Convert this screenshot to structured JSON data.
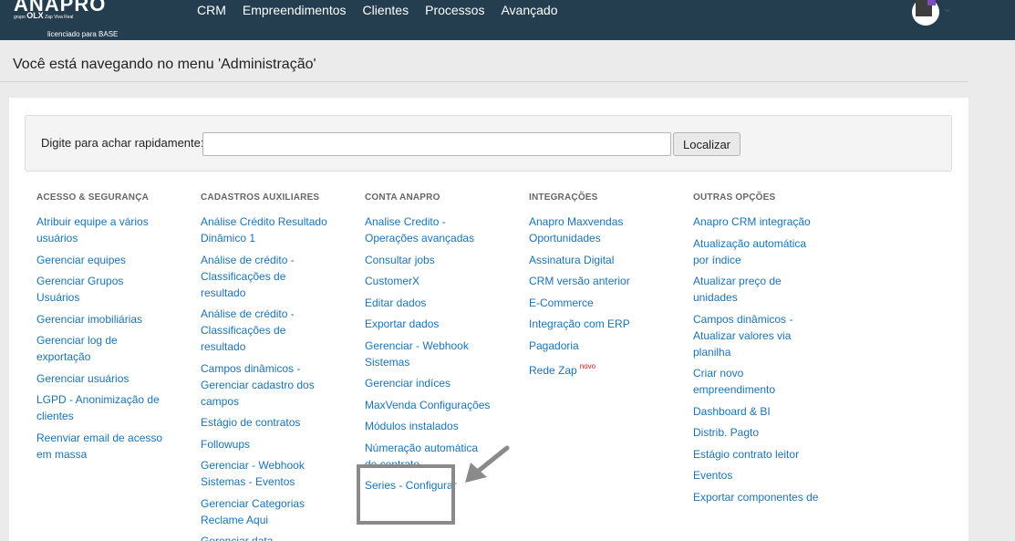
{
  "topbar": {
    "logo_text": "ANAPRO",
    "logo_sub_prefix": "grupo",
    "logo_sub_brand": "OLX",
    "logo_sub_rest": "Zap  Viva  Real",
    "licensed": "licenciado para BASE",
    "nav": [
      "CRM",
      "Empreendimentos",
      "Clientes",
      "Processos",
      "Avançado"
    ],
    "avatar_chevron": "⌄"
  },
  "page": {
    "title": "Você está navegando no menu 'Administração'"
  },
  "search": {
    "label": "Digite para achar rapidamente:",
    "value": "",
    "placeholder": "",
    "button": "Localizar"
  },
  "columns": [
    {
      "heading": "ACESSO & SEGURANÇA",
      "items": [
        "Atribuir equipe a vários usuários",
        "Gerenciar equipes",
        "Gerenciar Grupos Usuários",
        "Gerenciar imobiliárias",
        "Gerenciar log de exportação",
        "Gerenciar usuários",
        "LGPD - Anonimização de clientes",
        "Reenviar email de acesso em massa"
      ]
    },
    {
      "heading": "CADASTROS AUXILIARES",
      "items": [
        "Análise Crédito Resultado Dinâmico 1",
        "Análise de crédito - Classificações de resultado",
        "Análise de crédito - Classificações de resultado",
        "Campos dinâmicos - Gerenciar cadastro dos campos",
        "Estágio de contratos",
        "Followups",
        "Gerenciar - Webhook Sistemas - Eventos",
        "Gerenciar Categorias Reclame Aqui",
        "Gerenciar data"
      ]
    },
    {
      "heading": "CONTA ANAPRO",
      "items": [
        "Analise Credito - Operações avançadas",
        "Consultar jobs",
        "CustomerX",
        "Editar dados",
        "Exportar dados",
        "Gerenciar - Webhook Sistemas",
        "Gerenciar indíces",
        "MaxVenda Configurações",
        "Módulos instalados",
        "Númeração automática de contrato",
        "Series - Configurar"
      ]
    },
    {
      "heading": "INTEGRAÇÕES",
      "items": [
        "Anapro Maxvendas Oportunidades",
        "Assinatura Digital",
        "CRM versão anterior",
        "E-Commerce",
        "Integração com ERP",
        "Pagadoria",
        "Rede Zap"
      ],
      "new_badge": "novo"
    },
    {
      "heading": "OUTRAS OPÇÕES",
      "items": [
        "Anapro CRM integração",
        "Atualização automática por índice",
        "Atualizar preço de unidades",
        "Campos dinâmicos - Atualizar valores via planilha",
        "Criar novo empreendimento",
        "Dashboard & BI",
        "Distrib. Pagto",
        "Estágio contrato leitor",
        "Eventos",
        "Exportar componentes de"
      ]
    }
  ],
  "colors": {
    "topbar": "#243d4f",
    "link": "#1a73b5",
    "new_badge": "#dd1111",
    "highlight": "#8a8a8a"
  }
}
